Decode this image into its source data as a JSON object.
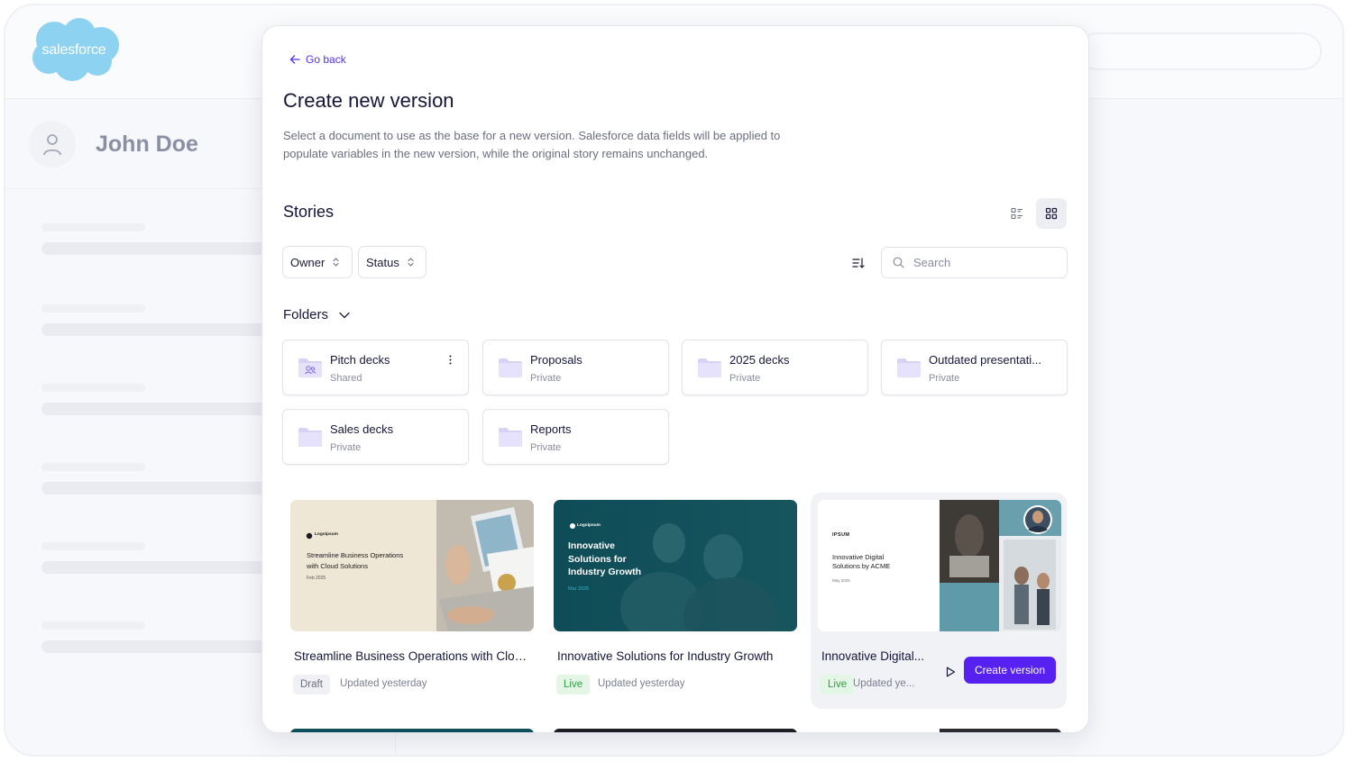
{
  "app": {
    "logo_text": "salesforce",
    "user_name": "John Doe",
    "colors": {
      "accent": "#5721F2",
      "link": "#5433E8",
      "logo": "#8ED2F2",
      "live": "#2F9E44"
    }
  },
  "modal": {
    "go_back": "Go back",
    "title": "Create new version",
    "description": "Select a document to use as the base for a new version. Salesforce data fields will be applied to populate variables in the new version, while the original story remains unchanged."
  },
  "stories": {
    "title": "Stories",
    "filters": {
      "owner": "Owner",
      "status": "Status"
    },
    "search_placeholder": "Search",
    "folders_title": "Folders",
    "folders": [
      {
        "name": "Pitch decks",
        "visibility": "Shared",
        "icon": "shared-folder-icon"
      },
      {
        "name": "Proposals",
        "visibility": "Private",
        "icon": "folder-icon"
      },
      {
        "name": "2025 decks",
        "visibility": "Private",
        "icon": "folder-icon"
      },
      {
        "name": "Outdated presentati...",
        "visibility": "Private",
        "icon": "folder-icon"
      },
      {
        "name": "Sales decks",
        "visibility": "Private",
        "icon": "folder-icon"
      },
      {
        "name": "Reports",
        "visibility": "Private",
        "icon": "folder-icon"
      }
    ],
    "cards": [
      {
        "title": "Streamline Business Operations with Clou...",
        "status": "Draft",
        "updated": "Updated yesterday",
        "thumb": {
          "brand": "Logoipsum",
          "heading_line1": "Streamline Business Operations",
          "heading_line2": "with Cloud Solutions",
          "date": "Feb 2025"
        }
      },
      {
        "title": "Innovative Solutions for Industry Growth",
        "status": "Live",
        "updated": "Updated yesterday",
        "thumb": {
          "brand": "Logoipsum",
          "heading_line1": "Innovative",
          "heading_line2": "Solutions for",
          "heading_line3": "Industry Growth",
          "date": "Mar 2025"
        }
      },
      {
        "title": "Innovative Digital...",
        "status": "Live",
        "updated": "Updated ye...",
        "create_label": "Create version",
        "thumb": {
          "brand": "IPSUM",
          "heading_line1": "Innovative Digital",
          "heading_line2": "Solutions by ACME",
          "date": "May 2025"
        }
      }
    ]
  }
}
